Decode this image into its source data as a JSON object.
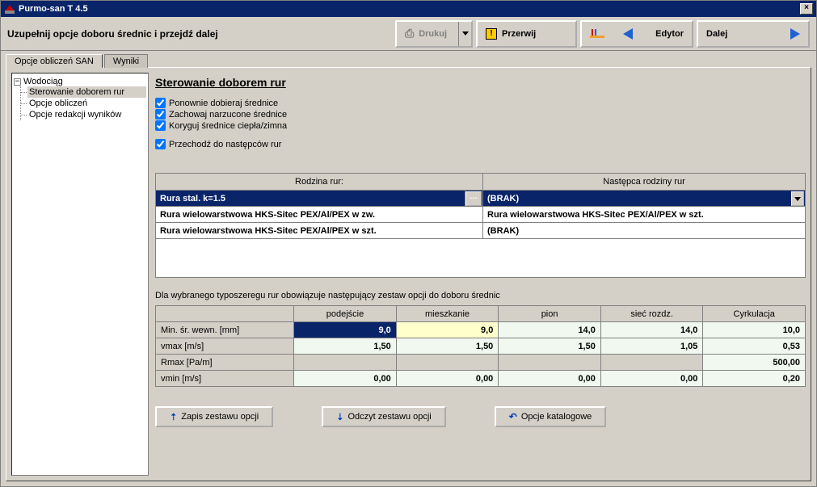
{
  "window": {
    "title": "Purmo-san T 4.5"
  },
  "toolbar": {
    "instruction": "Uzupełnij opcje doboru średnic i przejdź dalej",
    "print": "Drukuj",
    "interrupt": "Przerwij",
    "editor": "Edytor",
    "next": "Dalej"
  },
  "tabs": {
    "calc": "Opcje obliczeń SAN",
    "results": "Wyniki"
  },
  "tree": {
    "root": "Wodociąg",
    "items": [
      "Sterowanie doborem rur",
      "Opcje obliczeń",
      "Opcje redakcji wyników"
    ]
  },
  "section": {
    "title": "Sterowanie doborem rur",
    "checks": {
      "c1": "Ponownie dobieraj średnice",
      "c2": "Zachowaj narzucone średnice",
      "c3": "Koryguj średnice ciepła/zimna",
      "c4": "Przechodź do następców rur"
    }
  },
  "pipe": {
    "col1": "Rodzina rur:",
    "col2": "Następca rodziny rur",
    "rows": [
      {
        "family": "Rura stal. k=1.5",
        "succ": "(BRAK)"
      },
      {
        "family": "Rura wielowarstwowa HKS-Sitec PEX/Al/PEX w zw.",
        "succ": "Rura wielowarstwowa HKS-Sitec PEX/Al/PEX w szt."
      },
      {
        "family": "Rura wielowarstwowa HKS-Sitec PEX/Al/PEX w szt.",
        "succ": "(BRAK)"
      }
    ]
  },
  "info": "Dla wybranego typoszeregu rur obowiązuje następujący zestaw opcji do doboru średnic",
  "params": {
    "cols": [
      "podejście",
      "mieszkanie",
      "pion",
      "sieć rozdz.",
      "Cyrkulacja"
    ],
    "rows": {
      "r1": {
        "label": "Min. śr. wewn. [mm]",
        "v": [
          "9,0",
          "9,0",
          "14,0",
          "14,0",
          "10,0"
        ]
      },
      "r2": {
        "label": "vmax [m/s]",
        "v": [
          "1,50",
          "1,50",
          "1,50",
          "1,05",
          "0,53"
        ]
      },
      "r3": {
        "label": "Rmax [Pa/m]",
        "v": [
          "",
          "",
          "",
          "",
          "500,00"
        ]
      },
      "r4": {
        "label": "vmin [m/s]",
        "v": [
          "0,00",
          "0,00",
          "0,00",
          "0,00",
          "0,20"
        ]
      }
    }
  },
  "bottom": {
    "save": "Zapis zestawu opcji",
    "load": "Odczyt zestawu opcji",
    "catalog": "Opcje katalogowe"
  }
}
